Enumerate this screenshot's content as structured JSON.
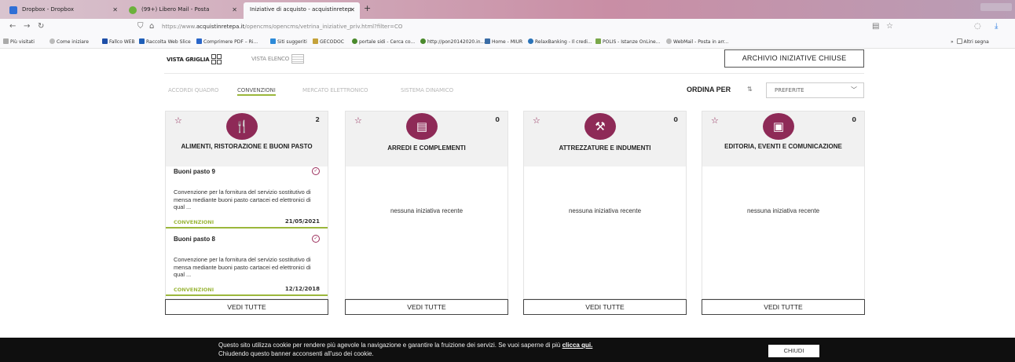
{
  "browser": {
    "tabs": [
      {
        "label": "Dropbox - Dropbox",
        "color": "#2f6fd6"
      },
      {
        "label": "(99+) Libero Mail - Posta",
        "color": "#6bb13b"
      },
      {
        "label": "Iniziative di acquisto - acquistinretep",
        "color": "#ffffff"
      }
    ],
    "url_prefix": "https://www.",
    "url_domain": "acquistinretepa.it",
    "url_path": "/opencms/opencms/vetrina_iniziative_priv.html?filter=CO",
    "bookmarks": [
      "Più visitati",
      "Come iniziare",
      "Fallco WEB",
      "Raccolta Web Slice",
      "Comprimere PDF – Ri...",
      "Siti suggeriti",
      "GECODOC",
      "portale sidi - Cerca co...",
      "http://pon20142020.in...",
      "Home - MIUR",
      "RelaxBanking - Il credi...",
      "POLIS - Istanze OnLine...",
      "WebMail - Posta in arr..."
    ],
    "other_bookmarks": "Altri segna"
  },
  "view": {
    "grid_label": "VISTA GRIGLIA",
    "list_label": "VISTA ELENCO"
  },
  "archive_button": "ARCHIVIO INIZIATIVE CHIUSE",
  "categories": [
    "ACCORDI QUADRO",
    "CONVENZIONI",
    "MERCATO ELETTRONICO",
    "SISTEMA DINAMICO"
  ],
  "sort": {
    "label": "ORDINA PER",
    "selected": "PREFERITE"
  },
  "cards": [
    {
      "title": "ALIMENTI, RISTORAZIONE E BUONI PASTO",
      "count": "2",
      "icon": "food-icon",
      "items": [
        {
          "title": "Buoni pasto 9",
          "desc": "Convenzione per la fornitura del servizio sostitutivo di mensa mediante buoni pasto cartacei ed elettronici di qual ...",
          "type": "CONVENZIONI",
          "date": "21/05/2021"
        },
        {
          "title": "Buoni pasto 8",
          "desc": "Convenzione per la fornitura del servizio sostitutivo di mensa mediante buoni pasto cartacei ed elettronici di qual ...",
          "type": "CONVENZIONI",
          "date": "12/12/2018"
        }
      ],
      "more": "VEDI TUTTE"
    },
    {
      "title": "ARREDI E COMPLEMENTI",
      "count": "0",
      "icon": "cabinet-icon",
      "empty": "nessuna iniziativa recente",
      "more": "VEDI TUTTE"
    },
    {
      "title": "ATTREZZATURE E INDUMENTI",
      "count": "0",
      "icon": "tools-icon",
      "empty": "nessuna iniziativa recente",
      "more": "VEDI TUTTE"
    },
    {
      "title": "EDITORIA, EVENTI E COMUNICAZIONE",
      "count": "0",
      "icon": "media-icon",
      "empty": "nessuna iniziativa recente",
      "more": "VEDI TUTTE"
    }
  ],
  "cookie": {
    "line1": "Questo sito utilizza cookie per rendere più agevole la navigazione e garantire la fruizione dei servizi. Se vuoi saperne di più",
    "link": "clicca qui.",
    "line2": "Chiudendo questo banner acconsenti all'uso dei cookie.",
    "close": "CHIUDI"
  },
  "colors": {
    "brand": "#8e2a57",
    "accent": "#9bb73b"
  }
}
